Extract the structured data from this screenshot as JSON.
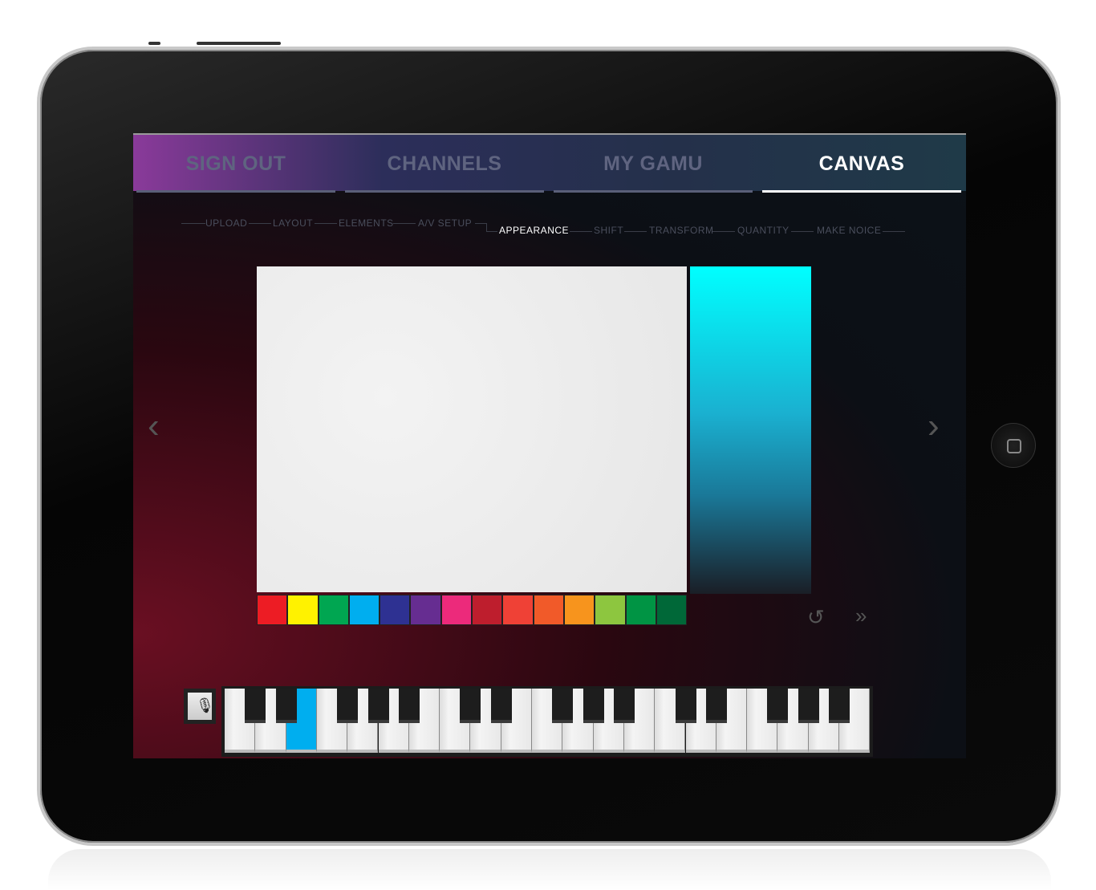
{
  "tabs": [
    {
      "label": "SIGN OUT",
      "active": false
    },
    {
      "label": "CHANNELS",
      "active": false
    },
    {
      "label": "MY GAMU",
      "active": false
    },
    {
      "label": "CANVAS",
      "active": true
    }
  ],
  "steps": [
    {
      "label": "UPLOAD"
    },
    {
      "label": "LAYOUT"
    },
    {
      "label": "ELEMENTS"
    },
    {
      "label": "A/V SETUP"
    },
    {
      "label": "APPEARANCE",
      "active": true
    },
    {
      "label": "SHIFT"
    },
    {
      "label": "TRANSFORM"
    },
    {
      "label": "QUANTITY"
    },
    {
      "label": "MAKE  NOICE"
    }
  ],
  "swatches": [
    "#ed1c24",
    "#fff200",
    "#00a651",
    "#00aeef",
    "#2e3192",
    "#662d91",
    "#ec2a7b",
    "#be1e2d",
    "#ef4136",
    "#f15a29",
    "#f7941d",
    "#8dc63f",
    "#009444",
    "#006838"
  ],
  "selected_color": "#00aeef",
  "icons": {
    "prev": "chevron-left-icon",
    "next": "chevron-right-icon",
    "reset": "rotate-ccw-icon",
    "forward": "double-chevron-right-icon",
    "mic": "microphone-icon"
  },
  "piano": {
    "white_keys": 21,
    "selected_white_key": 2,
    "black_after_white": [
      0,
      1,
      3,
      4,
      5,
      7,
      8,
      10,
      11,
      12,
      14,
      15,
      17,
      18,
      19
    ]
  }
}
